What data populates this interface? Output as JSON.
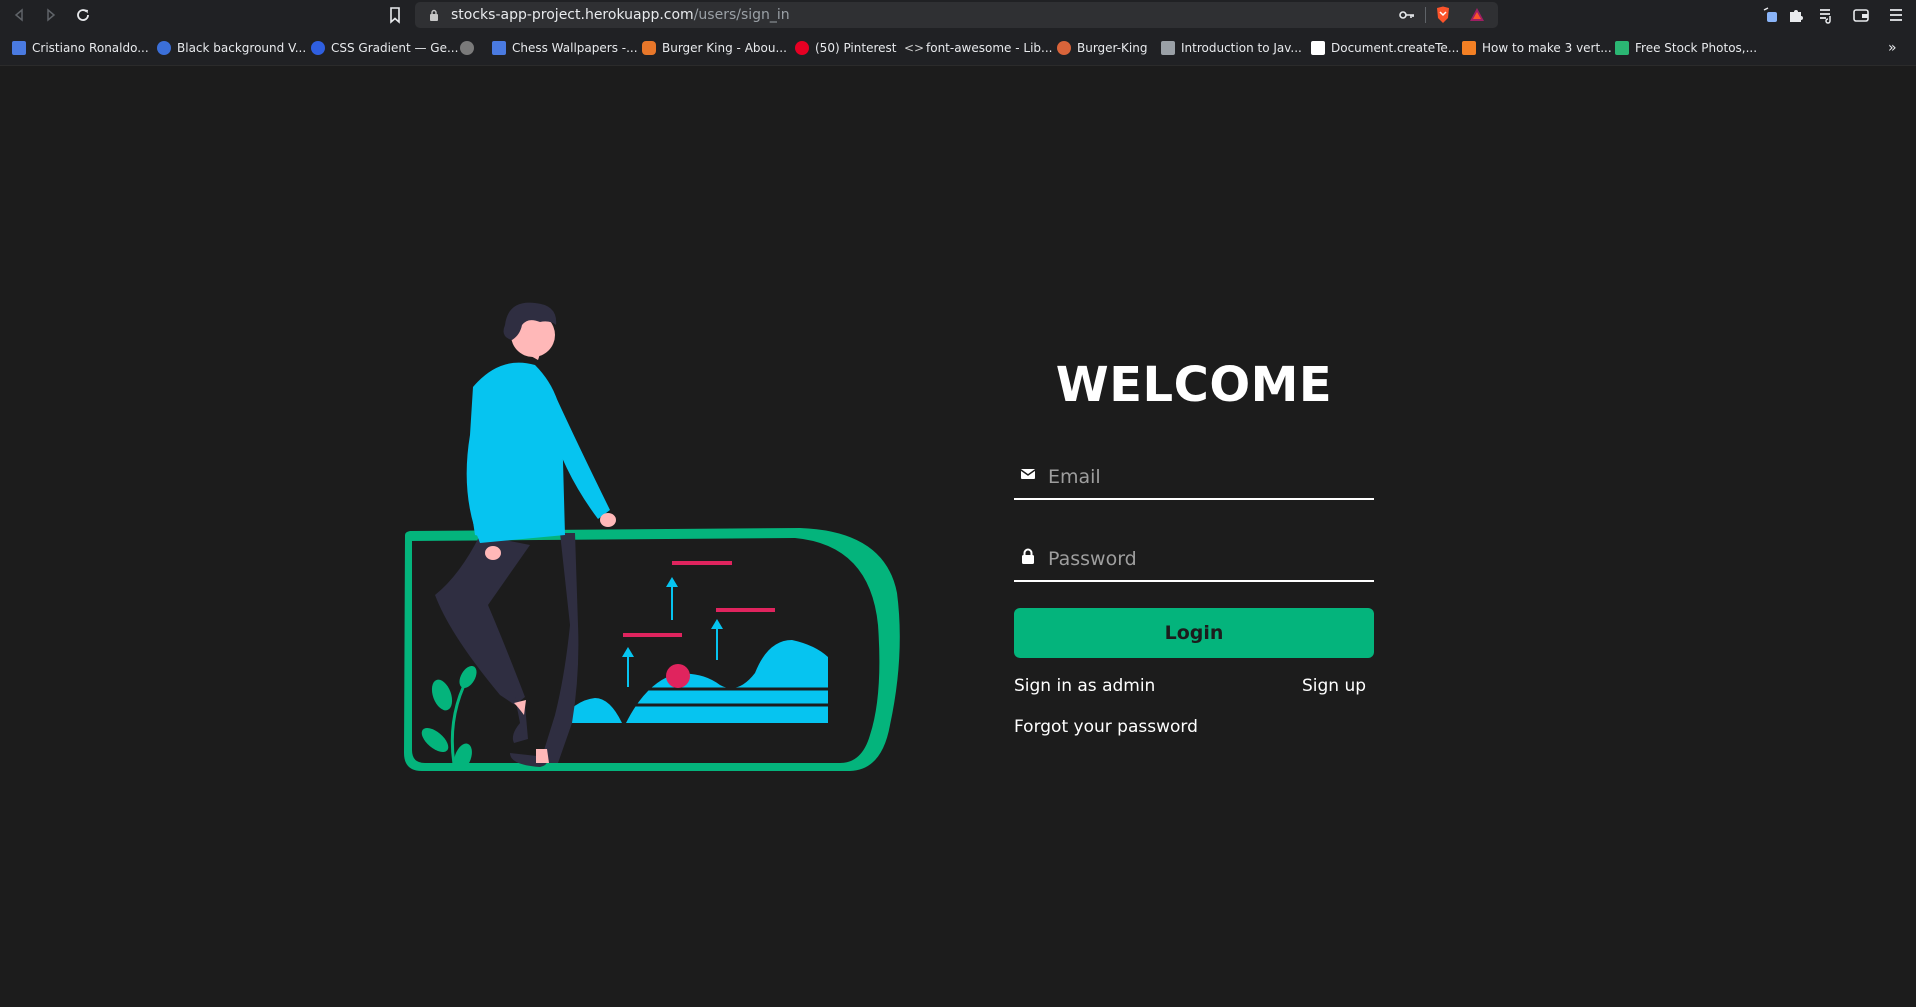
{
  "browser": {
    "url_domain": "stocks-app-project.herokuapp.com",
    "url_path": "/users/sign_in",
    "nav_icons": [
      "back-icon",
      "forward-icon",
      "reload-icon",
      "bookmark-icon",
      "key-icon",
      "brave-shield-icon",
      "brave-rewards-icon"
    ],
    "bookmarks": [
      {
        "label": "Cristiano Ronaldo...",
        "color": "#4a7ae0"
      },
      {
        "label": "Black background V...",
        "color": "#3b6fd8"
      },
      {
        "label": "CSS Gradient — Ge...",
        "color": "#2f5fe0"
      },
      {
        "label": "",
        "color": "#7a7a7a"
      },
      {
        "label": "Chess Wallpapers -...",
        "color": "#4a7ae0"
      },
      {
        "label": "Burger King - Abou...",
        "color": "#e8772a"
      },
      {
        "label": "(50) Pinterest",
        "color": "#e60023"
      },
      {
        "label": "font-awesome - Lib...",
        "color": "#d0d0d0"
      },
      {
        "label": "Burger-King",
        "color": "#d9643a"
      },
      {
        "label": "Introduction to Jav...",
        "color": "#9aa0a6"
      },
      {
        "label": "Document.createTe...",
        "color": "#ffffff"
      },
      {
        "label": "How to make 3 vert...",
        "color": "#f48024"
      },
      {
        "label": "Free Stock Photos,...",
        "color": "#2bb673"
      }
    ]
  },
  "page": {
    "title": "WELCOME",
    "email": {
      "placeholder": "Email",
      "value": ""
    },
    "password": {
      "placeholder": "Password",
      "value": ""
    },
    "login_label": "Login",
    "admin_link": "Sign in as admin",
    "signup_link": "Sign up",
    "forgot_link": "Forgot your password",
    "accent_color": "#04b47c",
    "background_color": "#1c1c1c"
  }
}
